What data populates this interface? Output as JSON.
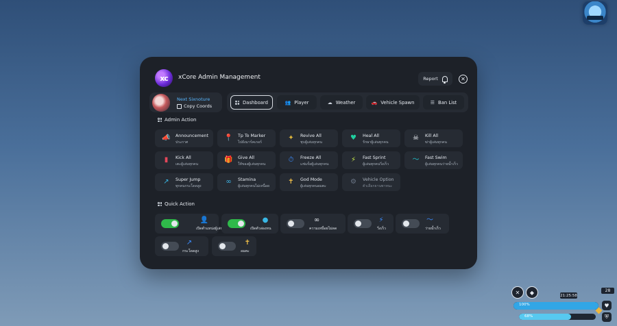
{
  "app": {
    "title": "xCore Admin Management",
    "logo_text": "xc"
  },
  "header": {
    "report_label": "Report",
    "close_symbol": "✕"
  },
  "profile": {
    "name": "Next Sixnoture",
    "copy_label": "Copy Coords"
  },
  "tabs": [
    {
      "label": "Dashboard",
      "icon": "grid-icon",
      "active": true
    },
    {
      "label": "Player",
      "icon": "users-icon",
      "active": false
    },
    {
      "label": "Weather",
      "icon": "cloud-icon",
      "active": false
    },
    {
      "label": "Vehicle Spawn",
      "icon": "car-icon",
      "active": false
    },
    {
      "label": "Ban List",
      "icon": "list-icon",
      "active": false
    }
  ],
  "admin_action": {
    "title": "Admin Action",
    "items": [
      {
        "label": "Announcement",
        "sub": "ประกาศ",
        "icon": "megaphone-icon",
        "glyph": "📣",
        "color": "#3b7cff"
      },
      {
        "label": "Tp To Marker",
        "sub": "ไปยังมาร์คเกอร์",
        "icon": "map-pin-icon",
        "glyph": "📍",
        "color": "#2f82ff"
      },
      {
        "label": "Revive All",
        "sub": "ชุบผู้เล่นทุกคน",
        "icon": "revive-icon",
        "glyph": "✦",
        "color": "#e2b83c"
      },
      {
        "label": "Heal All",
        "sub": "รักษาผู้เล่นทุกคน",
        "icon": "heal-icon",
        "glyph": "♥",
        "color": "#1fcf9f"
      },
      {
        "label": "Kill All",
        "sub": "ฆ่าผู้เล่นทุกคน",
        "icon": "skull-icon",
        "glyph": "☠",
        "color": "#e7ebf1"
      },
      {
        "label": "Kick All",
        "sub": "เตะผู้เล่นทุกคน",
        "icon": "door-icon",
        "glyph": "▮",
        "color": "#e3475a"
      },
      {
        "label": "Give All",
        "sub": "ให้ของผู้เล่นทุกคน",
        "icon": "gift-icon",
        "glyph": "🎁",
        "color": "#f0a63a"
      },
      {
        "label": "Freeze All",
        "sub": "แช่แข็งผู้เล่นทุกคน",
        "icon": "freeze-icon",
        "glyph": "⏱",
        "color": "#3c8dff"
      },
      {
        "label": "Fast Sprint",
        "sub": "ผู้เล่นทุกคนวิ่งเร็ว",
        "icon": "sprint-icon",
        "glyph": "⚡",
        "color": "#c8e84a"
      },
      {
        "label": "Fast Swim",
        "sub": "ผู้เล่นทุกคนว่ายน้ำเร็ว",
        "icon": "swim-icon",
        "glyph": "〜",
        "color": "#22c1c9"
      },
      {
        "label": "Super Jump",
        "sub": "ทุกคนกระโดดสูง",
        "icon": "jump-icon",
        "glyph": "↗",
        "color": "#39b7e5"
      },
      {
        "label": "Stamina",
        "sub": "ผู้เล่นทุกคนไม่เหนื่อย",
        "icon": "infinity-icon",
        "glyph": "∞",
        "color": "#3fb6e8"
      },
      {
        "label": "God Mode",
        "sub": "ผู้เล่นทุกคนอมตะ",
        "icon": "cross-icon",
        "glyph": "✝",
        "color": "#f2c04a"
      },
      {
        "label": "Vehicle Option",
        "sub": "ตัวเลือกยานพาหนะ",
        "icon": "vehicle-icon",
        "glyph": "⚙",
        "color": "#6b7686",
        "dim": true
      }
    ]
  },
  "quick_action": {
    "title": "Quick Action",
    "items": [
      {
        "label": "เปิดตำแหน่งผู้เล่น",
        "icon": "player-location-icon",
        "glyph": "👤",
        "color": "#3aa2ff",
        "on": true
      },
      {
        "label": "เปิดตัวล่องหน",
        "icon": "ghost-icon",
        "glyph": "●",
        "color": "#39b7e5",
        "on": true
      },
      {
        "label": "ความเหนื่อยไม่ลด",
        "icon": "infinity-icon",
        "glyph": "∞",
        "color": "#e7ebf1",
        "on": false
      },
      {
        "label": "วิ่งเร็ว",
        "icon": "sprint-icon",
        "glyph": "⚡",
        "color": "#3c8dff",
        "on": false
      },
      {
        "label": "ว่ายน้ำเร็ว",
        "icon": "swim-icon",
        "glyph": "〜",
        "color": "#3c8dff",
        "on": false
      },
      {
        "label": "กระโดดสูง",
        "icon": "jump-icon",
        "glyph": "↗",
        "color": "#3c8dff",
        "on": false
      },
      {
        "label": "อมตะ",
        "icon": "cross-icon",
        "glyph": "✝",
        "color": "#f2c04a",
        "on": false
      }
    ]
  },
  "hud": {
    "time": "21:25:58",
    "counter": "28",
    "bar1": {
      "label": "100%",
      "value": 100,
      "color": "#32a6e6"
    },
    "bar2": {
      "label": "68%",
      "value": 68,
      "color": "#57c9f0"
    }
  }
}
